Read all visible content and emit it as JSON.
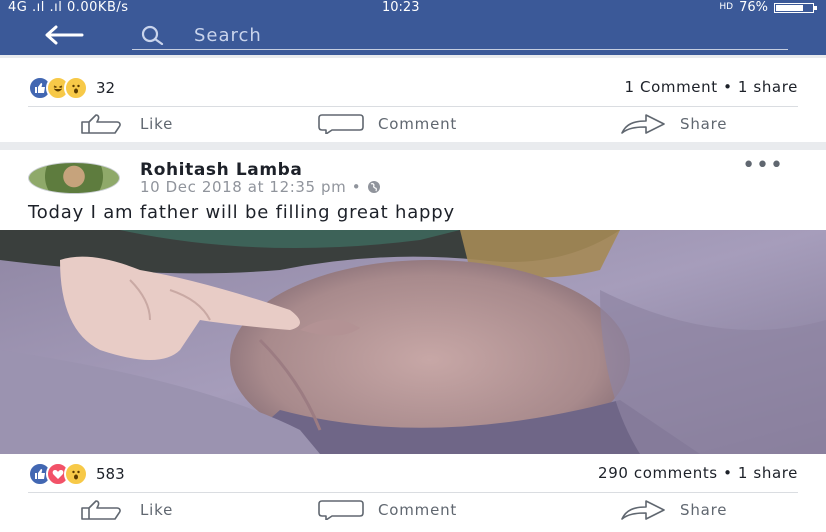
{
  "status_bar": {
    "signal": "4G .ıl .ıl",
    "speed": "0.00KB/s",
    "time": "10:23",
    "hd": "HD",
    "battery": "76%",
    "battery_level": 0.76
  },
  "nav": {
    "search_placeholder": "Search"
  },
  "post1": {
    "reaction_count": "32",
    "stats": "1 Comment • 1 share",
    "reactions": [
      "like-icon",
      "haha-icon",
      "wow-icon"
    ]
  },
  "post2": {
    "author": "Rohitash Lamba",
    "timestamp": "10 Dec 2018 at 12:35 pm •",
    "text": "Today I am father will be filling great happy",
    "reaction_count": "583",
    "stats": "290 comments • 1 share",
    "reactions": [
      "like-icon",
      "love-icon",
      "wow-icon"
    ]
  },
  "actions": {
    "like": "Like",
    "comment": "Comment",
    "share": "Share"
  },
  "colors": {
    "brand": "#3b5998",
    "like_blue": "#4267b2",
    "love_red": "#f25268",
    "emoji_yellow": "#f7c948"
  }
}
